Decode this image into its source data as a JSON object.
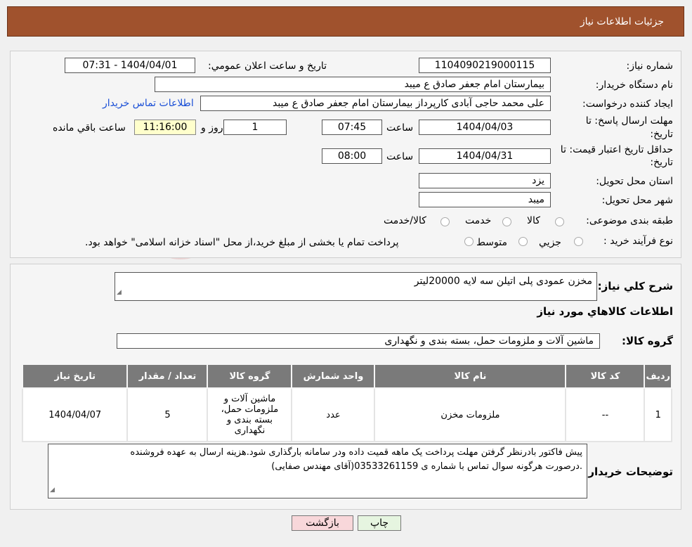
{
  "header": {
    "title": "جزئیات اطلاعات نیاز"
  },
  "fields": {
    "need_number_label": "شماره نیاز:",
    "need_number": "1104090219000115",
    "announce_label": "تاریخ و ساعت اعلان عمومي:",
    "announce_value": "1404/04/01 - 07:31",
    "buyer_label": "نام دستگاه خريدار:",
    "buyer_value": "بیمارستان امام جعفر صادق  ع  میبد",
    "creator_label": "ایجاد کننده درخواست:",
    "creator_value": "علی محمد حاجی آبادی کارپرداز بیمارستان امام جعفر صادق  ع  میبد",
    "contact_link": "اطلاعات تماس خریدار",
    "deadline_label_1": "مهلت ارسال پاسخ: تا",
    "deadline_label_2": "تاریخ:",
    "deadline_date": "1404/04/03",
    "time_label": "ساعت",
    "deadline_time": "07:45",
    "days_value": "1",
    "days_label": "روز و",
    "remaining_value": "11:16:00",
    "remaining_label": "ساعت باقي مانده",
    "validity_label_1": "حداقل تاریخ اعتبار قیمت: تا",
    "validity_label_2": "تاریخ:",
    "validity_date": "1404/04/31",
    "validity_time": "08:00",
    "province_label": "استان محل تحویل:",
    "province_value": "یزد",
    "city_label": "شهر محل تحویل:",
    "city_value": "میبد",
    "category_label": "طبقه بندی موضوعی:",
    "category_opt1": "کالا",
    "category_opt2": "خدمت",
    "category_opt3": "کالا/خدمت",
    "process_label": "نوع فرآیند خرید :",
    "process_opt1": "جزیي",
    "process_opt2": "متوسط",
    "process_note": "پرداخت تمام یا بخشی از مبلغ خرید،از محل \"اسناد خزانه اسلامی\" خواهد بود."
  },
  "summary": {
    "label": "شرح کلي نياز:",
    "value": "مخزن  عمودی پلی اتیلن سه لایه 20000لیتر",
    "goods_info_title": "اطلاعات کالاهاي مورد نياز",
    "group_label": "گروه کالا:",
    "group_value": "ماشین آلات و ملزومات حمل، بسته بندی و نگهداری"
  },
  "table": {
    "headers": [
      "ردیف",
      "کد کالا",
      "نام کالا",
      "واحد شمارش",
      "گروه کالا",
      "تعداد / مقدار",
      "تاریخ نیاز"
    ],
    "rows": [
      [
        "1",
        "--",
        "ملزومات مخزن",
        "عدد",
        "ماشین آلات و ملزومات حمل، بسته بندی و نگهداری",
        "5",
        "1404/04/07"
      ]
    ]
  },
  "notes": {
    "label": "توضیحات خریدار:",
    "line1": "پیش فاکتور بادرنظر گرفتن مهلت پرداخت یک ماهه قمیت داده ودر سامانه بارگذاری شود.هزینه ارسال به عهده فروشنده",
    "line2": ".درصورت هرگونه سوال تماس با شماره ی 03533261159(آقای مهندس صفایی)"
  },
  "buttons": {
    "print": "چاپ",
    "back": "بازگشت"
  },
  "colors": {
    "header": "#a0522d",
    "link": "#1a4fd6",
    "table_header": "#7a7a7a",
    "back_button": "#f8d7da",
    "print_button": "#e6f5e0"
  }
}
